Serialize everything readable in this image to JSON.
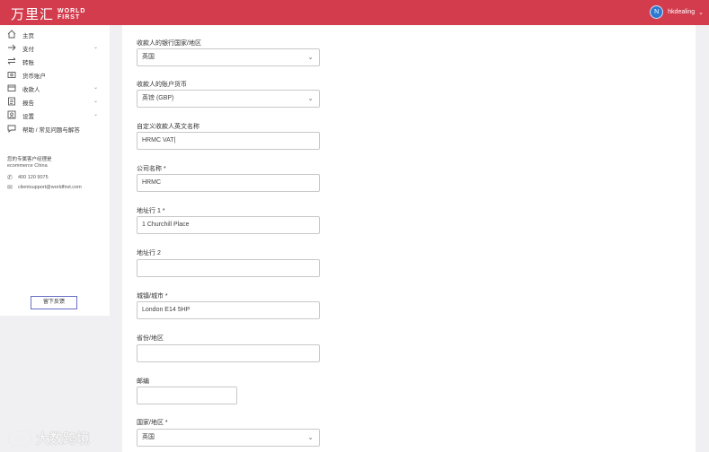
{
  "header": {
    "logo_cn": "万里汇",
    "logo_en_line1": "WORLD",
    "logo_en_line2": "FIRST",
    "user_initial": "N",
    "user_name": "hkdealing"
  },
  "sidebar": {
    "items": [
      {
        "label": "主页",
        "icon": "home-icon"
      },
      {
        "label": "支付",
        "icon": "arrow-right-icon",
        "has_chevron": true
      },
      {
        "label": "转账",
        "icon": "transfer-icon"
      },
      {
        "label": "货币账户",
        "icon": "wallet-icon"
      },
      {
        "label": "收款人",
        "icon": "payee-icon",
        "has_chevron": true
      },
      {
        "label": "报告",
        "icon": "report-icon",
        "has_chevron": true
      },
      {
        "label": "设置",
        "icon": "settings-icon",
        "has_chevron": true
      },
      {
        "label": "帮助 / 常见问题与解答",
        "icon": "help-icon"
      }
    ],
    "account_manager_title": "您的专属客户经理是",
    "account_manager_name": "ecommerce China",
    "phone": "400 120 9075",
    "email": "clientsupport@worldfirst.com",
    "feedback_label": "留下反馈"
  },
  "form": {
    "bank_country": {
      "label": "收款人的银行国家/地区",
      "value": "英国"
    },
    "currency": {
      "label": "收款人的账户货币",
      "value": "英镑 (GBP)"
    },
    "custom_name": {
      "label": "自定义收款人英文名称",
      "value": "HRMC VAT|"
    },
    "company": {
      "label": "公司名称 *",
      "value": "HRMC"
    },
    "address1": {
      "label": "地址行 1 *",
      "value": "1 Churchill Place"
    },
    "address2": {
      "label": "地址行 2",
      "value": ""
    },
    "city": {
      "label": "城镇/城市 *",
      "value": "London E14 5HP"
    },
    "province": {
      "label": "省份/地区",
      "value": ""
    },
    "postcode": {
      "label": "邮编",
      "value": ""
    },
    "country": {
      "label": "国家/地区 *",
      "value": "英国"
    }
  },
  "watermark": {
    "badge": "KD",
    "text": "大数跨境"
  },
  "colors": {
    "brand": "#d23c4d",
    "avatar": "#2e7ad1",
    "button_border": "#6a6fc5"
  }
}
